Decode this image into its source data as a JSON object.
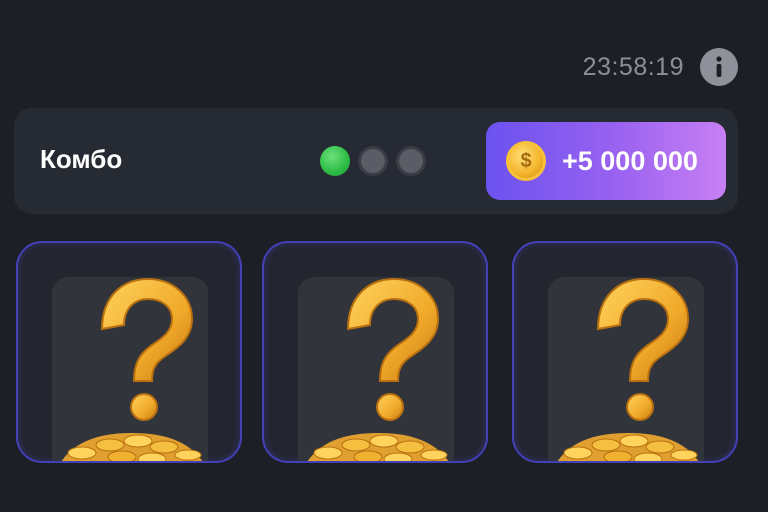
{
  "header": {
    "timer": "23:58:19",
    "info_icon": "info-icon"
  },
  "combo": {
    "title": "Комбо",
    "progress": {
      "found": 1,
      "total": 3
    },
    "reward": {
      "icon": "coin-icon",
      "coin_symbol": "$",
      "amount": "+5 000 000"
    }
  },
  "cards": [
    {
      "state": "hidden",
      "icon": "question-coins-icon"
    },
    {
      "state": "hidden",
      "icon": "question-coins-icon"
    },
    {
      "state": "hidden",
      "icon": "question-coins-icon"
    }
  ],
  "colors": {
    "background": "#1c1f26",
    "panel": "#262a33",
    "accent_gradient_start": "#6b52ef",
    "accent_gradient_end": "#c880f4",
    "dot_done": "#2fbf47",
    "dot_empty": "#5a5d65",
    "card_border": "#4340b8",
    "gold": "#f0a92a"
  }
}
